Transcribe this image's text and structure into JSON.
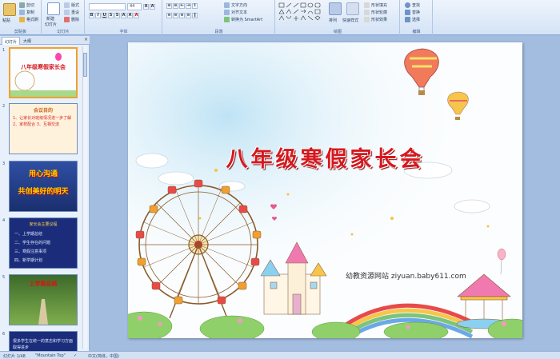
{
  "ribbon": {
    "clipboard": {
      "label": "剪贴板",
      "paste": "粘贴",
      "cut": "剪切",
      "copy": "复制",
      "format_painter": "格式刷"
    },
    "slides": {
      "label": "幻灯片",
      "new_slide": "新建",
      "new_slide_line2": "幻灯片",
      "layout": "版式",
      "reset": "重设",
      "delete": "删除"
    },
    "font": {
      "label": "字体",
      "font_name": "",
      "font_size": "44"
    },
    "paragraph": {
      "label": "段落",
      "text_direction": "文字方向",
      "align_text": "对齐文本",
      "smartart": "转换为 SmartArt"
    },
    "drawing": {
      "label": "绘图",
      "arrange": "排列",
      "quick_styles": "快速样式",
      "shape_fill": "形状填充",
      "shape_outline": "形状轮廓",
      "shape_effects": "形状效果"
    },
    "editing": {
      "label": "编辑",
      "find": "查找",
      "replace": "替换",
      "select": "选择"
    }
  },
  "panel_tabs": {
    "slides": "幻灯片",
    "outline": "大纲",
    "close": "×"
  },
  "thumbnails": [
    {
      "number": "1",
      "title": "八年级寒假家长会"
    },
    {
      "number": "2",
      "heading": "会议目的",
      "body": "1、让家长对班级情况进一步了解 2、家校配合 3、互相交流"
    },
    {
      "number": "3",
      "line1": "用心沟通",
      "line2": "共创美好的明天"
    },
    {
      "number": "4",
      "heading": "家长会主要议程",
      "items": [
        "一、上学期总结",
        "二、学生存在的问题",
        "三、寒假注意事项",
        "四、新学期计划"
      ]
    },
    {
      "number": "5",
      "heading": "上学期总结"
    },
    {
      "number": "6",
      "body": "很多学生在统一的意志和学习方面取得进步"
    }
  ],
  "slide": {
    "title": "八年级寒假家长会",
    "watermark": "幼教资源网站  ziyuan.baby611.com"
  },
  "statusbar": {
    "slide_counter": "幻灯片 1/48",
    "theme": "\"Mountain Top\"",
    "language": "中文(简体，中国)"
  },
  "colors": {
    "title_red": "#d4181e",
    "ribbon_bg": "#dce8f7",
    "stage_bg": "#a3bde0"
  }
}
